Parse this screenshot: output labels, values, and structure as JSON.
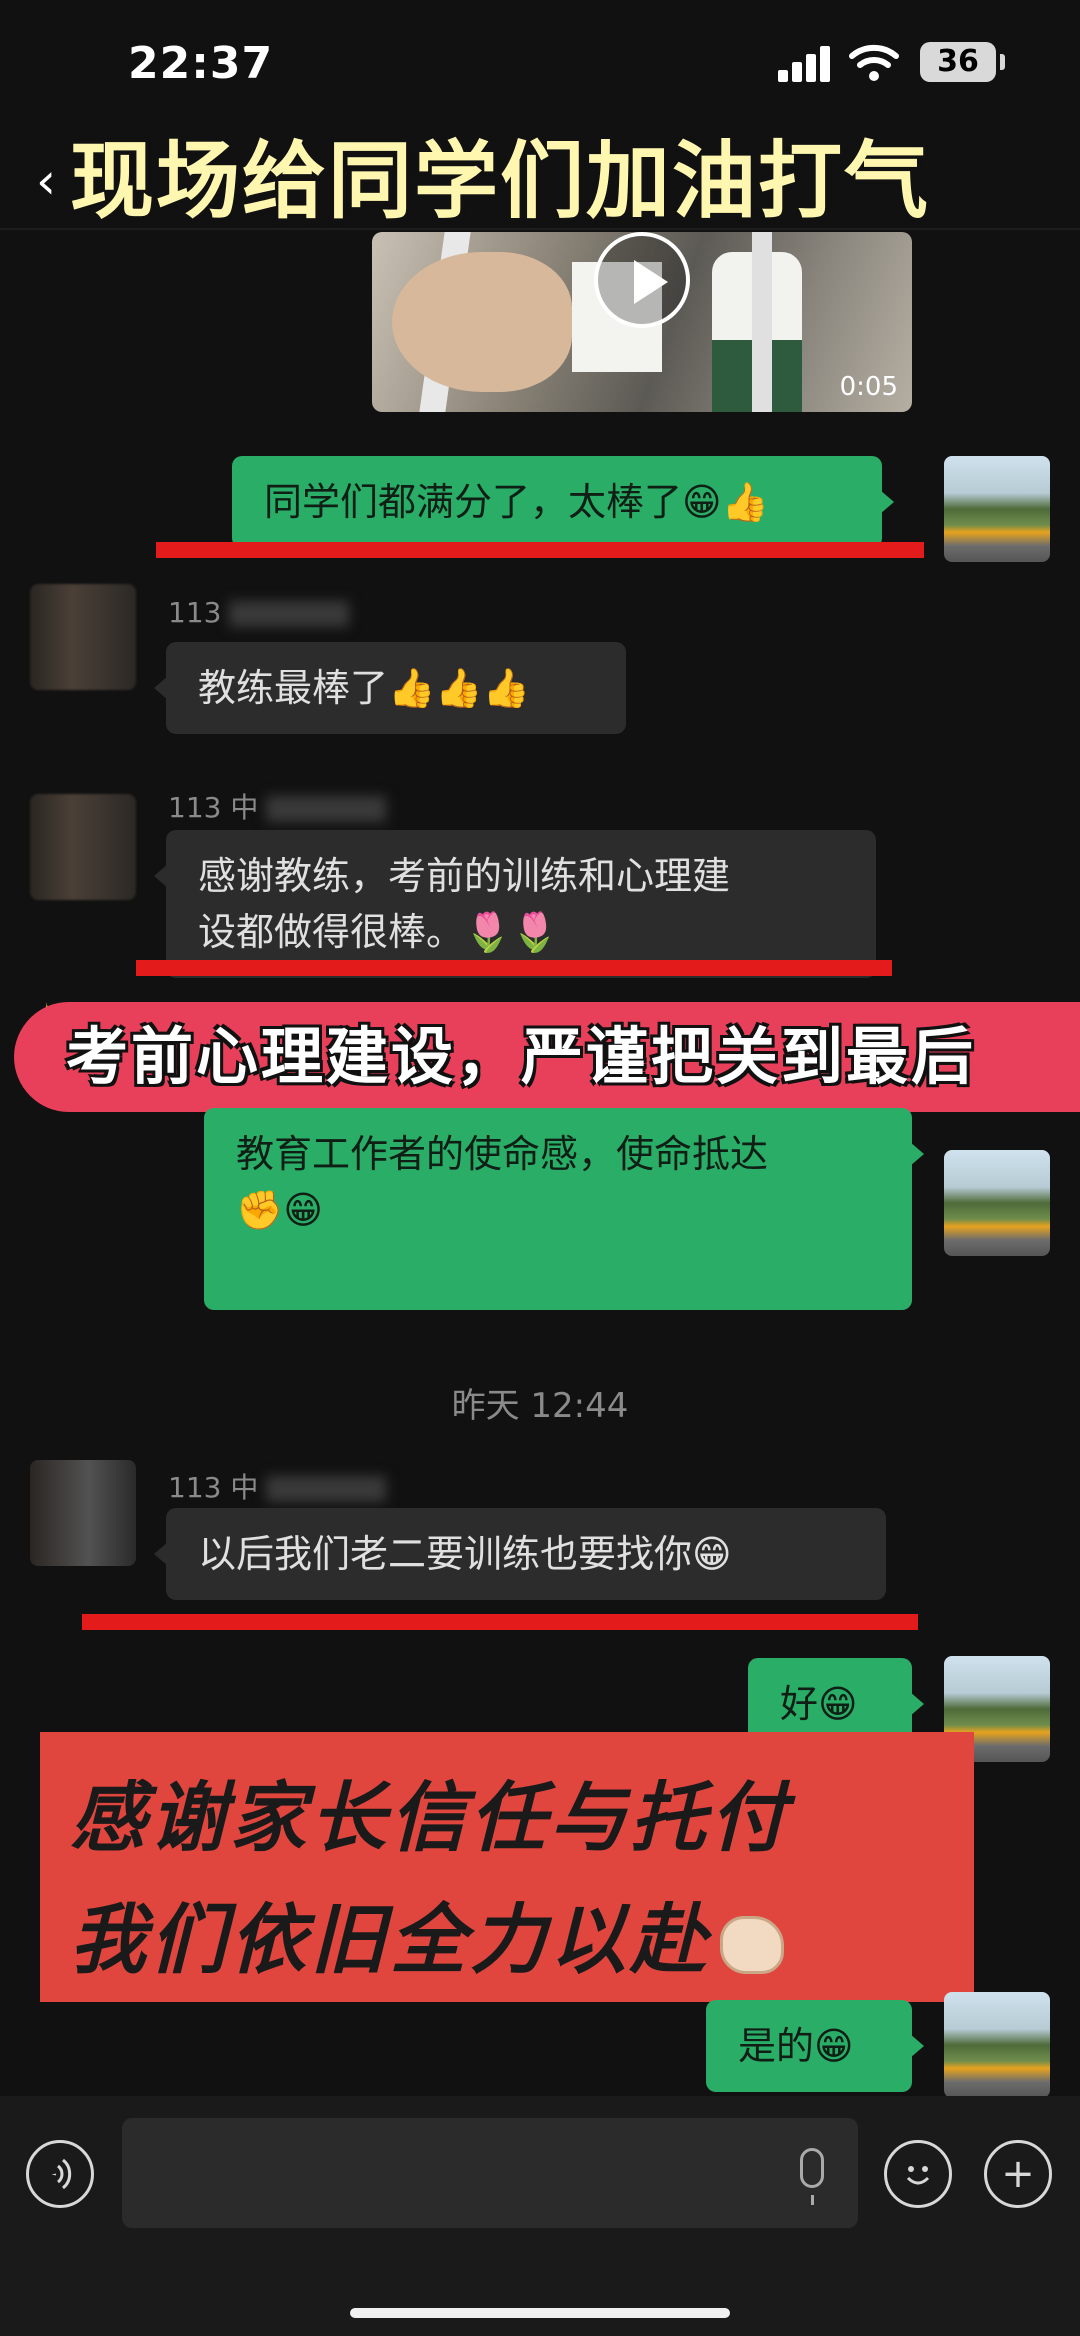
{
  "status_bar": {
    "time": "22:37",
    "battery": "36"
  },
  "title_bar": {
    "back_icon": "‹",
    "overlay_title": "现场给同学们加油打气"
  },
  "video": {
    "duration": "0:05"
  },
  "messages": [
    {
      "side": "right",
      "text": "同学们都满分了，太棒了😁👍"
    },
    {
      "side": "left",
      "sender": "113",
      "text": "教练最棒了👍👍👍"
    },
    {
      "side": "left",
      "sender": "113 中",
      "text_line1": "感谢教练，考前的训练和心理建",
      "text_line2": "设都做得很棒。🌷🌷"
    },
    {
      "side": "right",
      "text_line1": "教育工作者的使命感，使命抵达",
      "text_line2": "✊😁"
    },
    {
      "side": "left",
      "sender": "113 中",
      "text": "以后我们老二要训练也要找你😁"
    },
    {
      "side": "right",
      "text": "好😁"
    },
    {
      "side": "right",
      "text": "是的😁"
    }
  ],
  "timestamp": "昨天 12:44",
  "banner": {
    "text": "考前心理建设，严谨把关到最后",
    "sparkle": "✦"
  },
  "overlay_card": {
    "line1": "感谢家长信任与托付",
    "line2": "我们依旧全力以赴"
  },
  "input_bar": {
    "voice_icon": "voice-icon",
    "emoji_icon": "emoji-icon",
    "plus_icon": "plus-icon"
  },
  "colors": {
    "green_bubble": "#2aae67",
    "gray_bubble": "#2c2c2c",
    "banner": "#e8405a",
    "underline": "#e41b1b",
    "card": "#e0463e"
  }
}
